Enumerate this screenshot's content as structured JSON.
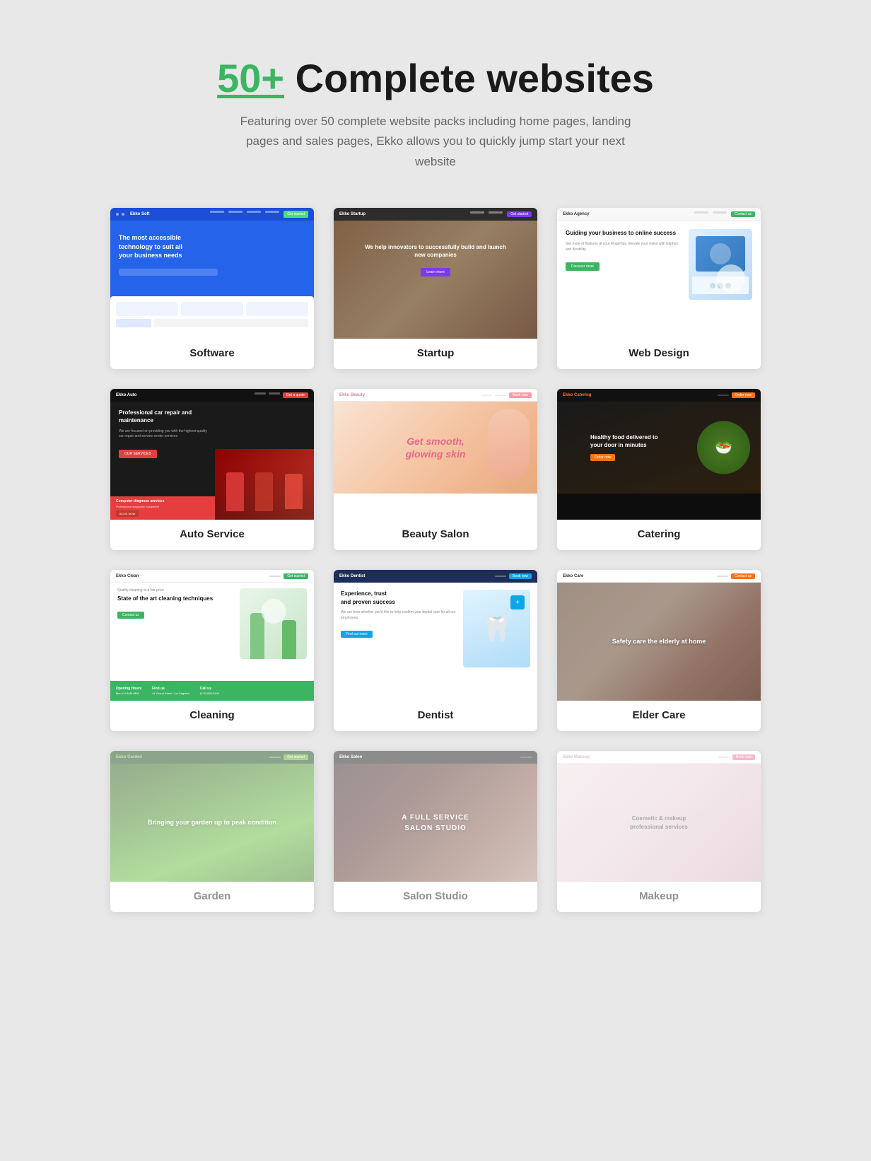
{
  "header": {
    "title_number": "50+",
    "title_rest": " Complete websites",
    "subtitle": "Featuring over 50 complete website packs including home pages, landing pages and sales pages, Ekko allows you to quickly jump start your next website"
  },
  "cards": [
    {
      "id": "software",
      "label": "Software",
      "theme": "software",
      "hero": "The most accessible technology to suit all your business needs"
    },
    {
      "id": "startup",
      "label": "Startup",
      "theme": "startup",
      "hero": "We help innovators to successfully build and launch new companies"
    },
    {
      "id": "webdesign",
      "label": "Web Design",
      "theme": "webdesign",
      "hero": "Guiding your business to online success"
    },
    {
      "id": "auto",
      "label": "Auto Service",
      "theme": "auto",
      "hero": "Professional car repair and maintenance"
    },
    {
      "id": "beauty",
      "label": "Beauty Salon",
      "theme": "beauty",
      "hero": "Get smooth, glowing skin"
    },
    {
      "id": "catering",
      "label": "Catering",
      "theme": "catering",
      "hero": "Healthy food delivered to your door in minutes"
    },
    {
      "id": "cleaning",
      "label": "Cleaning",
      "theme": "cleaning",
      "hero": "State of the art cleaning techniques"
    },
    {
      "id": "dentist",
      "label": "Dentist",
      "theme": "dentist",
      "hero": "Experience, trust and proven success"
    },
    {
      "id": "eldercare",
      "label": "Elder Care",
      "theme": "eldercare",
      "hero": "Safety care the elderly at home"
    },
    {
      "id": "garden",
      "label": "Garden",
      "theme": "garden",
      "hero": "Bringing your garden up to peak condition"
    },
    {
      "id": "salon",
      "label": "Salon Studio",
      "theme": "salon",
      "hero": "A Full Service Salon Studio"
    },
    {
      "id": "makeup",
      "label": "Makeup",
      "theme": "makeup",
      "hero": "Cosmetic & makeup professional services"
    }
  ]
}
